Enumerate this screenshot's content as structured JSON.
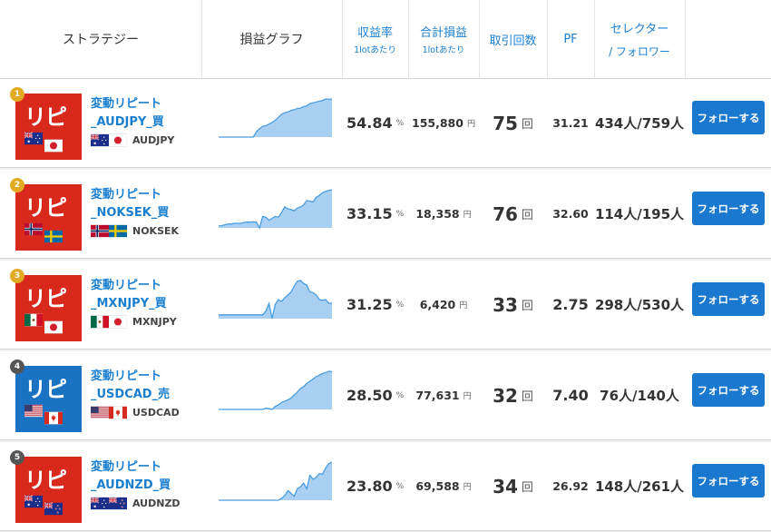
{
  "header": {
    "strategy": "ストラテジー",
    "graph": "損益グラフ",
    "return_rate": "収益率",
    "return_rate_sub": "1lotあたり",
    "total_pl": "合計損益",
    "total_pl_sub": "1lotあたり",
    "trades": "取引回数",
    "pf": "PF",
    "selector": "セレクター",
    "follower": "/ フォロワー"
  },
  "units": {
    "percent": "%",
    "yen": "円",
    "times": "回"
  },
  "colors": {
    "accent": "#1b7fd0",
    "button": "#1a78cf",
    "logo_red": "#d9291c",
    "logo_blue": "#1a72c2",
    "chart_fill": "#a9d0f2",
    "chart_line": "#4a9de0"
  },
  "rows": [
    {
      "rank": "1",
      "rank_color": "#e2aa20",
      "logo_color": "#d9291c",
      "logo_text": "リピ",
      "name_line1": "変動リピート",
      "name_line2": "_AUDJPY_買",
      "pair": "AUDJPY",
      "flag1": "au",
      "flag2": "jp",
      "return": "54.84",
      "pl": "155,880",
      "trades": "75",
      "pf": "31.21",
      "selector": "434人/759人",
      "button": "フォローする",
      "chart": [
        0,
        0,
        0,
        0,
        0,
        0,
        0,
        0,
        0,
        0,
        0,
        0,
        0.14,
        0.22,
        0.28,
        0.3,
        0.34,
        0.38,
        0.44,
        0.52,
        0.6,
        0.64,
        0.66,
        0.7,
        0.72,
        0.75,
        0.76,
        0.8,
        0.82,
        0.88,
        0.9,
        0.92,
        0.94,
        0.96,
        1.0,
        0.99,
        1.0
      ]
    },
    {
      "rank": "2",
      "rank_color": "#e2aa20",
      "logo_color": "#d9291c",
      "logo_text": "リピ",
      "name_line1": "変動リピート",
      "name_line2": "_NOKSEK_買",
      "pair": "NOKSEK",
      "flag1": "no",
      "flag2": "se",
      "return": "33.15",
      "pl": "18,358",
      "trades": "76",
      "pf": "32.60",
      "selector": "114人/195人",
      "button": "フォローする",
      "chart": [
        0.05,
        0.06,
        0.08,
        0.1,
        0.1,
        0.12,
        0.12,
        0.12,
        0.14,
        0.15,
        0.15,
        0.16,
        0.15,
        0.0,
        0.3,
        0.28,
        0.2,
        0.25,
        0.3,
        0.28,
        0.4,
        0.55,
        0.5,
        0.48,
        0.45,
        0.52,
        0.55,
        0.6,
        0.72,
        0.7,
        0.68,
        0.8,
        0.85,
        0.92,
        0.96,
        0.98,
        1.0
      ]
    },
    {
      "rank": "3",
      "rank_color": "#e2aa20",
      "logo_color": "#d9291c",
      "logo_text": "リピ",
      "name_line1": "変動リピート",
      "name_line2": "_MXNJPY_買",
      "pair": "MXNJPY",
      "flag1": "mx",
      "flag2": "jp",
      "return": "31.25",
      "pl": "6,420",
      "trades": "33",
      "pf": "2.75",
      "selector": "298人/530人",
      "button": "フォローする",
      "chart": [
        0.1,
        0.1,
        0.1,
        0.1,
        0.1,
        0.1,
        0.1,
        0.1,
        0.1,
        0.1,
        0.1,
        0.1,
        0.1,
        0.1,
        0.1,
        0.2,
        0.4,
        0.0,
        0.38,
        0.5,
        0.45,
        0.55,
        0.62,
        0.7,
        0.85,
        0.98,
        1.0,
        0.92,
        0.88,
        0.7,
        0.68,
        0.62,
        0.5,
        0.48,
        0.5,
        0.4,
        0.4
      ]
    },
    {
      "rank": "4",
      "rank_color": "#555555",
      "logo_color": "#1a72c2",
      "logo_text": "リピ",
      "name_line1": "変動リピート",
      "name_line2": "_USDCAD_売",
      "pair": "USDCAD",
      "flag1": "us",
      "flag2": "ca",
      "return": "28.50",
      "pl": "77,631",
      "trades": "32",
      "pf": "7.40",
      "selector": "76人/140人",
      "button": "フォローする",
      "chart": [
        0,
        0,
        0,
        0,
        0,
        0,
        0,
        0,
        0,
        0,
        0,
        0,
        0,
        0,
        0,
        0.03,
        0.02,
        0.0,
        0.08,
        0.12,
        0.18,
        0.22,
        0.25,
        0.3,
        0.38,
        0.45,
        0.55,
        0.6,
        0.68,
        0.74,
        0.8,
        0.86,
        0.9,
        0.94,
        0.97,
        1.0,
        0.99
      ]
    },
    {
      "rank": "5",
      "rank_color": "#555555",
      "logo_color": "#d9291c",
      "logo_text": "リピ",
      "name_line1": "変動リピート",
      "name_line2": "_AUDNZD_買",
      "pair": "AUDNZD",
      "flag1": "au",
      "flag2": "nz",
      "return": "23.80",
      "pl": "69,588",
      "trades": "34",
      "pf": "26.92",
      "selector": "148人/261人",
      "button": "フォローする",
      "chart": [
        0,
        0,
        0,
        0,
        0,
        0,
        0,
        0,
        0,
        0,
        0,
        0,
        0,
        0,
        0,
        0,
        0,
        0,
        0,
        0,
        0.05,
        0.12,
        0.25,
        0.18,
        0.1,
        0.3,
        0.35,
        0.45,
        0.3,
        0.65,
        0.55,
        0.6,
        0.7,
        0.68,
        0.85,
        0.96,
        1.0
      ]
    }
  ]
}
